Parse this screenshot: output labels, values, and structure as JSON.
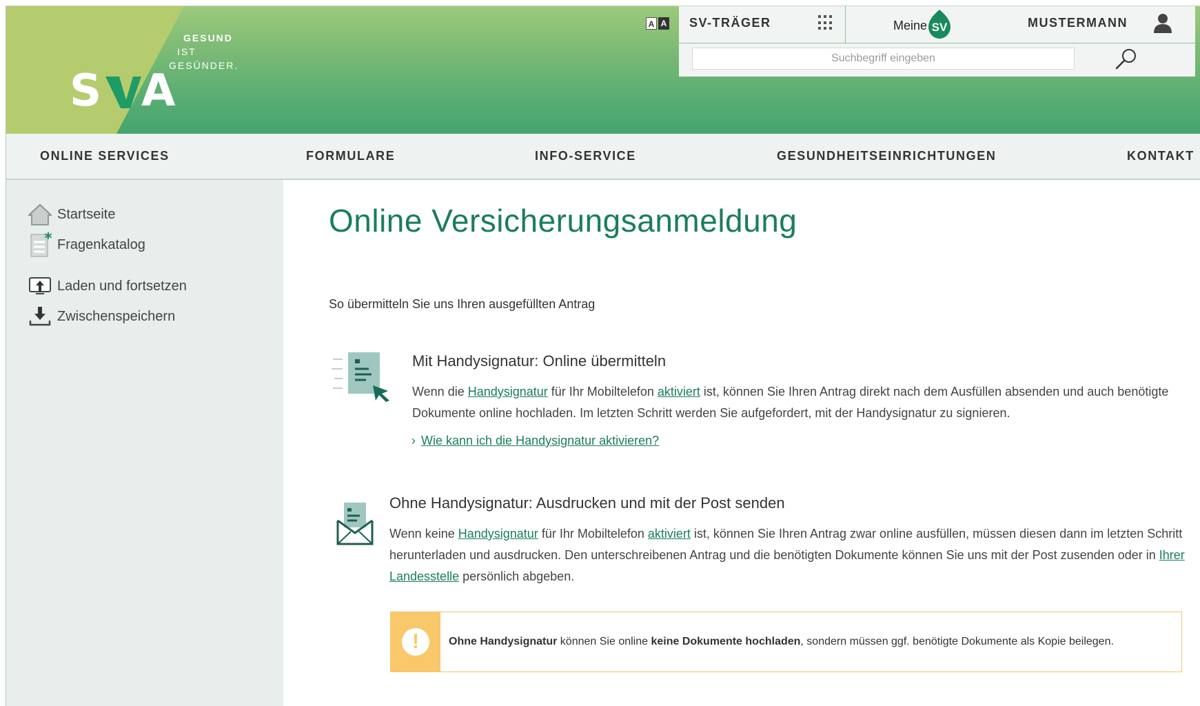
{
  "header": {
    "tagline": [
      "GESUND",
      "IST",
      "GESÜNDER."
    ],
    "logo_text": "SVA",
    "font_toggle": [
      "A",
      "A"
    ],
    "sv_traeger_label": "SV-TRÄGER",
    "meine_label": "Meine",
    "meine_sv_logo": "SV",
    "user_name": "MUSTERMANN",
    "search": {
      "placeholder": "Suchbegriff eingeben",
      "value": ""
    }
  },
  "nav": {
    "items": [
      {
        "label": "ONLINE SERVICES"
      },
      {
        "label": "FORMULARE"
      },
      {
        "label": "INFO-SERVICE"
      },
      {
        "label": "GESUNDHEITSEINRICHTUNGEN"
      },
      {
        "label": "KONTAKT"
      }
    ]
  },
  "sidebar": {
    "items": [
      {
        "label": "Startseite",
        "icon": "home-icon"
      },
      {
        "label": "Fragenkatalog",
        "icon": "questionnaire-icon"
      },
      {
        "label": "Laden und fortsetzen",
        "icon": "upload-icon"
      },
      {
        "label": "Zwischenspeichern",
        "icon": "download-icon"
      }
    ]
  },
  "main": {
    "title": "Online Versicherungsanmeldung",
    "intro": "So übermitteln Sie uns Ihren ausgefüllten Antrag",
    "section1": {
      "heading": "Mit Handysignatur: Online übermitteln",
      "text_1": "Wenn die ",
      "link_1": "Handysignatur",
      "text_2": " für Ihr Mobiltelefon ",
      "link_2": "aktiviert",
      "text_3": " ist, können Sie Ihren Antrag direkt nach dem Ausfüllen absenden und auch benötigte Dokumente online hochladen. Im letzten Schritt werden Sie aufgefordert, mit der Handysignatur zu signieren.",
      "faq_link": "Wie kann ich die Handysignatur aktivieren?"
    },
    "section2": {
      "heading": "Ohne Handysignatur: Ausdrucken und mit der Post senden",
      "text_1": "Wenn keine ",
      "link_1": "Handysignatur",
      "text_2": " für Ihr Mobiltelefon ",
      "link_2": "aktiviert",
      "text_3": " ist, können Sie Ihren Antrag zwar online ausfüllen, müssen diesen dann im letzten Schritt herunterladen und ausdrucken. Den unterschreibenen Antrag und die benötigten Dokumente können Sie uns mit der Post zusenden oder in ",
      "link_3": "Ihrer Landesstelle",
      "text_4": " persönlich abgeben."
    },
    "warning": {
      "icon_glyph": "!",
      "bold_1": "Ohne Handysignatur",
      "text_1": " können Sie online ",
      "bold_2": "keine Dokumente hochladen",
      "text_2": ", sondern müssen ggf. benötigte Dokumente als Kopie beilegen."
    }
  },
  "colors": {
    "brand_green": "#1a7d5e",
    "header_gradient_top": "#9cc97a",
    "header_gradient_bottom": "#45a46e",
    "warning_yellow": "#f9c86a",
    "sidebar_bg": "#e8eeec"
  }
}
